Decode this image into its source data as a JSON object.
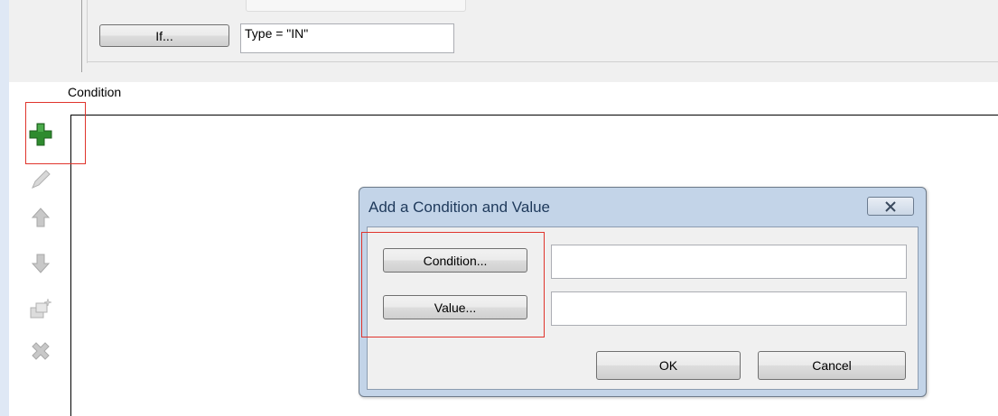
{
  "top": {
    "if_button_label": "If...",
    "if_field_value": "Type = \"IN\""
  },
  "condition_section": {
    "label": "Condition"
  },
  "toolbar": {
    "icons": [
      "add-icon",
      "edit-icon",
      "move-up-icon",
      "move-down-icon",
      "copy-icon",
      "delete-icon"
    ],
    "enabled": [
      "add-icon"
    ]
  },
  "dialog": {
    "title": "Add a Condition and Value",
    "condition_button_label": "Condition...",
    "value_button_label": "Value...",
    "condition_field_value": "",
    "value_field_value": "",
    "ok_label": "OK",
    "cancel_label": "Cancel"
  },
  "colors": {
    "highlight": "#e0342c",
    "add_icon": "#2e8b2e",
    "dialog_frame": "#c3d4e8"
  }
}
